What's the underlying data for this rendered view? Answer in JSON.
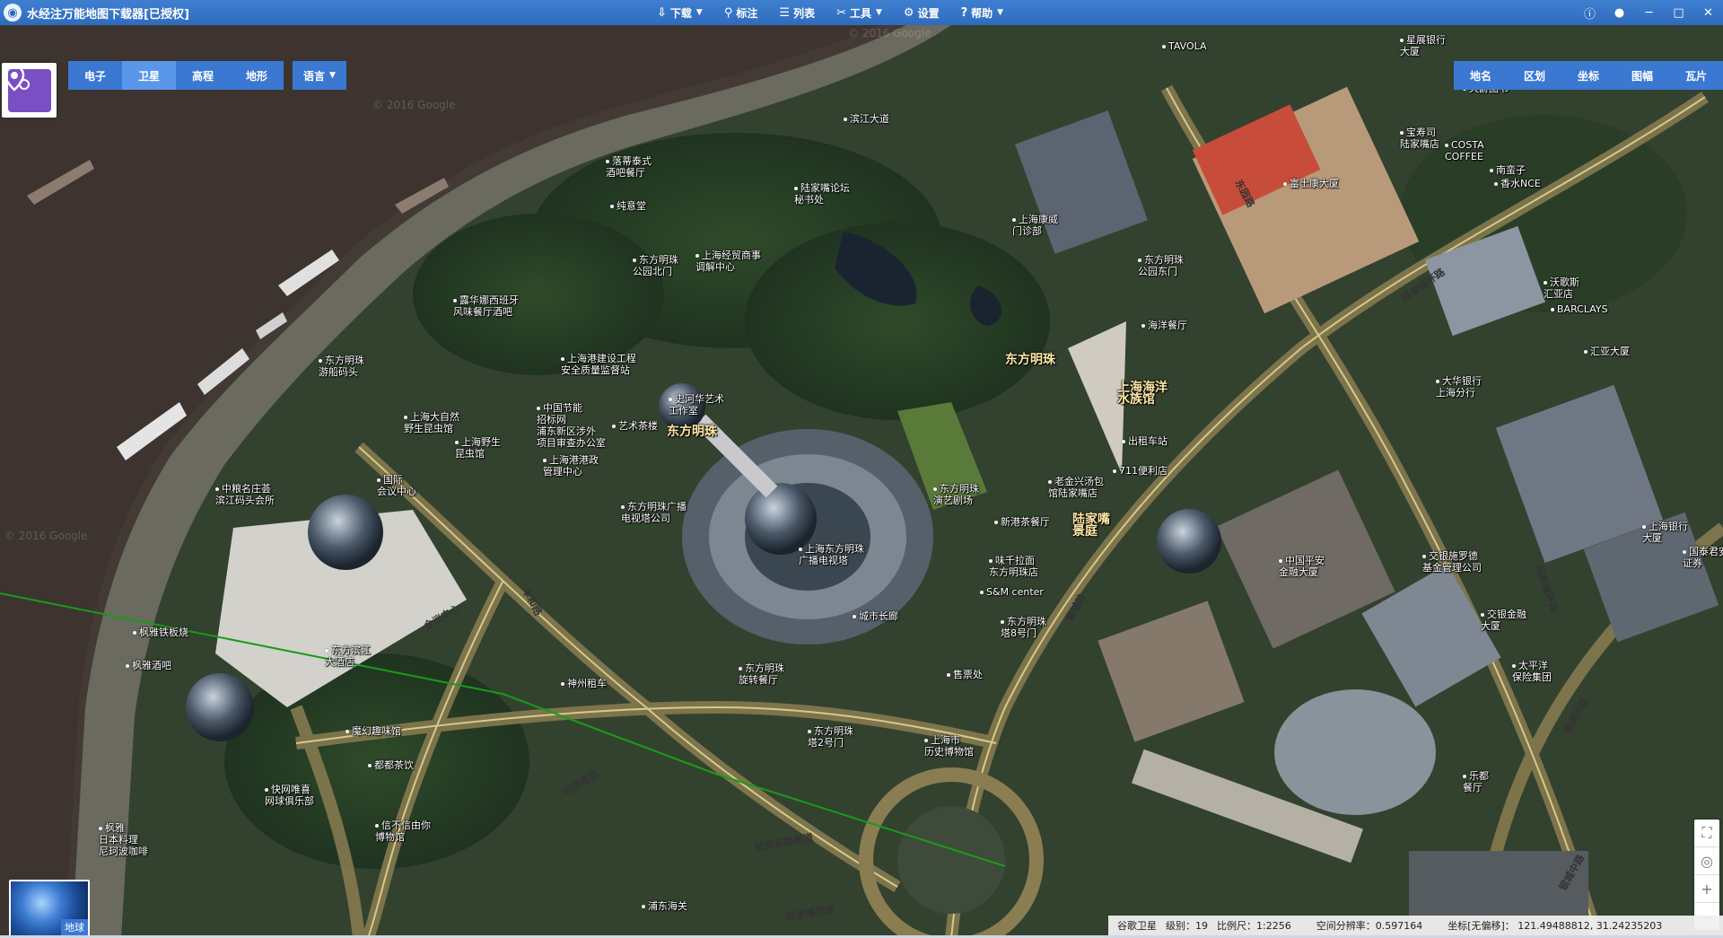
{
  "app": {
    "title": "水经注万能地图下载器[已授权]"
  },
  "menu": [
    {
      "icon": "download-icon",
      "glyph": "⇩",
      "label": "下载",
      "caret": true
    },
    {
      "icon": "pin-icon",
      "glyph": "⚲",
      "label": "标注",
      "caret": false
    },
    {
      "icon": "list-icon",
      "glyph": "☰",
      "label": "列表",
      "caret": false
    },
    {
      "icon": "tools-icon",
      "glyph": "✂",
      "label": "工具",
      "caret": true
    },
    {
      "icon": "gear-icon",
      "glyph": "⚙",
      "label": "设置",
      "caret": false
    },
    {
      "icon": "help-icon",
      "glyph": "?",
      "label": "帮助",
      "caret": true
    }
  ],
  "window_controls": [
    {
      "name": "info-icon",
      "glyph": "ⓘ"
    },
    {
      "name": "user-icon",
      "glyph": "●"
    },
    {
      "name": "minimize-icon",
      "glyph": "─"
    },
    {
      "name": "maximize-icon",
      "glyph": "□"
    },
    {
      "name": "close-icon",
      "glyph": "✕"
    }
  ],
  "map_types": [
    {
      "label": "电子",
      "active": false
    },
    {
      "label": "卫星",
      "active": true
    },
    {
      "label": "高程",
      "active": false
    },
    {
      "label": "地形",
      "active": false
    }
  ],
  "language": {
    "label": "语言"
  },
  "right_tabs": [
    "地名",
    "区划",
    "坐标",
    "图幅",
    "瓦片"
  ],
  "globe": {
    "label": "地球"
  },
  "watermarks": [
    "© 2016 Google",
    "© 2016 Google",
    "© 2016 Google"
  ],
  "status": {
    "source": "谷歌卫星",
    "level": "级别：19",
    "scale": "比例尺：1:2256",
    "resolution": "空间分辨率：0.597164",
    "coord": "坐标[无偏移]： 121.49488812, 31.24235203"
  },
  "labels": {
    "big": [
      {
        "t": "东方明珠"
      },
      {
        "t": "东方明珠"
      },
      {
        "t": "上海海洋\n水族馆"
      },
      {
        "t": "陆家嘴\n景庭"
      }
    ],
    "roads": [
      {
        "t": "东园路"
      },
      {
        "t": "陆家嘴环路"
      },
      {
        "t": "丰和路"
      },
      {
        "t": "会议中心"
      },
      {
        "t": "明珠塔路"
      },
      {
        "t": "延安东路隧道"
      },
      {
        "t": "陆家嘴西路"
      },
      {
        "t": "银城中路"
      },
      {
        "t": "富城路"
      },
      {
        "t": "陆家嘴环路"
      },
      {
        "t": "银城中路"
      }
    ],
    "poi": [
      {
        "t": "TAVOLA"
      },
      {
        "t": "滨江大道"
      },
      {
        "t": "星展银行\n大厦"
      },
      {
        "t": "天爵图书"
      },
      {
        "t": "宝寿司\n陆家嘴店"
      },
      {
        "t": "COSTA\nCOFFEE"
      },
      {
        "t": "南蛮子"
      },
      {
        "t": "富士康大厦"
      },
      {
        "t": "香水NCE"
      },
      {
        "t": "落蒂泰式\n酒吧餐厅"
      },
      {
        "t": "纯意堂"
      },
      {
        "t": "陆家嘴论坛\n秘书处"
      },
      {
        "t": "上海康威\n门诊部"
      },
      {
        "t": "东方明珠\n公园北门"
      },
      {
        "t": "上海经贸商事\n调解中心"
      },
      {
        "t": "东方明珠\n公园东门"
      },
      {
        "t": "沃歌斯\n汇亚店"
      },
      {
        "t": "BARCLAYS"
      },
      {
        "t": "露华娜西班牙\n风味餐厅酒吧"
      },
      {
        "t": "海洋餐厅"
      },
      {
        "t": "汇亚大厦"
      },
      {
        "t": "东方明珠\n游船码头"
      },
      {
        "t": "上海港建设工程\n安全质量监督站"
      },
      {
        "t": "大华银行\n上海分行"
      },
      {
        "t": "史河华艺术\n工作室"
      },
      {
        "t": "中国节能\n招标网\n浦东新区涉外\n项目审查办公室"
      },
      {
        "t": "上海大自然\n野生昆虫馆"
      },
      {
        "t": "艺术茶楼"
      },
      {
        "t": "上海野生\n昆虫馆"
      },
      {
        "t": "上海港港政\n管理中心"
      },
      {
        "t": "出租车站"
      },
      {
        "t": "中粮名庄荟\n滨江码头会所"
      },
      {
        "t": "国际\n会议中心"
      },
      {
        "t": "711便利店"
      },
      {
        "t": "东方明珠广播\n电视塔公司"
      },
      {
        "t": "老金兴汤包\n馆陆家嘴店"
      },
      {
        "t": "东方明珠\n演艺剧场"
      },
      {
        "t": "上海银行\n大厦"
      },
      {
        "t": "新港茶餐厅"
      },
      {
        "t": "上海东方明珠\n广播电视塔"
      },
      {
        "t": "味千拉面\n东方明珠店"
      },
      {
        "t": "交银施罗德\n基金管理公司"
      },
      {
        "t": "国泰君安\n证券"
      },
      {
        "t": "中国平安\n金融大厦"
      },
      {
        "t": "S&M center"
      },
      {
        "t": "东方明珠\n塔8号门"
      },
      {
        "t": "交银金融\n大厦"
      },
      {
        "t": "城市长廊"
      },
      {
        "t": "枫雅铁板烧"
      },
      {
        "t": "东方滨江\n大酒店"
      },
      {
        "t": "枫雅酒吧"
      },
      {
        "t": "东方明珠\n旋转餐厅"
      },
      {
        "t": "太平洋\n保险集团"
      },
      {
        "t": "神州租车"
      },
      {
        "t": "售票处"
      },
      {
        "t": "魔幻趣味馆"
      },
      {
        "t": "东方明珠\n塔2号门"
      },
      {
        "t": "上海市\n历史博物馆"
      },
      {
        "t": "都都茶饮"
      },
      {
        "t": "快网唯喜\n网球俱乐部"
      },
      {
        "t": "乐都\n餐厅"
      },
      {
        "t": "枫雅\n日本料理\n尼珂波咖啡"
      },
      {
        "t": "信不信由你\n博物馆"
      },
      {
        "t": "浦东海关"
      }
    ]
  }
}
